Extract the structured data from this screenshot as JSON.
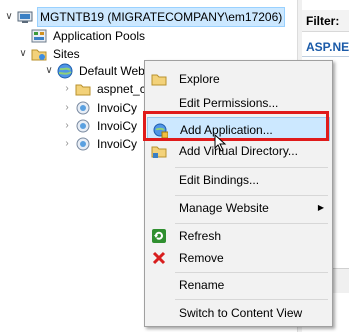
{
  "tree": {
    "server_label": "MGTNTB19 (MIGRATECOMPANY\\em17206)",
    "app_pools_label": "Application Pools",
    "sites_label": "Sites",
    "default_site_label": "Default Web Site",
    "children": [
      "aspnet_client",
      "InvoiCy",
      "InvoiCy",
      "InvoiCy"
    ]
  },
  "right_pane": {
    "filter_label": "Filter:",
    "asp_label": "ASP.NET"
  },
  "context_menu": {
    "items": [
      "Explore",
      "Edit Permissions...",
      "Add Application...",
      "Add Virtual Directory...",
      "Edit Bindings...",
      "Manage Website",
      "Refresh",
      "Remove",
      "Rename",
      "Switch to Content View"
    ]
  }
}
